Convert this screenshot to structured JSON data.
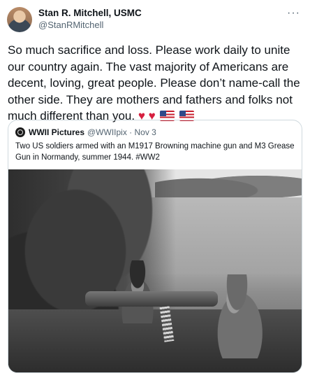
{
  "author": {
    "name": "Stan R. Mitchell, USMC",
    "handle": "@StanRMitchell"
  },
  "more_menu": "···",
  "tweet": {
    "text": "So much sacrifice and loss. Please work daily to unite our country again. The vast majority of Americans are decent, loving, great people. Please don’t name-call the other side. They are mothers and fathers and folks not much different than you.",
    "emoji": [
      "heart",
      "heart",
      "us-flag",
      "us-flag"
    ]
  },
  "quoted": {
    "name": "WWII Pictures",
    "handle": "@WWIIpix · Nov 3",
    "text": "Two US soldiers armed with an M1917 Browning machine gun and M3 Grease Gun in Normandy, summer 1944. #WW2"
  },
  "colors": {
    "text": "#0f1419",
    "muted": "#536471",
    "border": "#cfd9de",
    "heart": "#d61f3f"
  }
}
